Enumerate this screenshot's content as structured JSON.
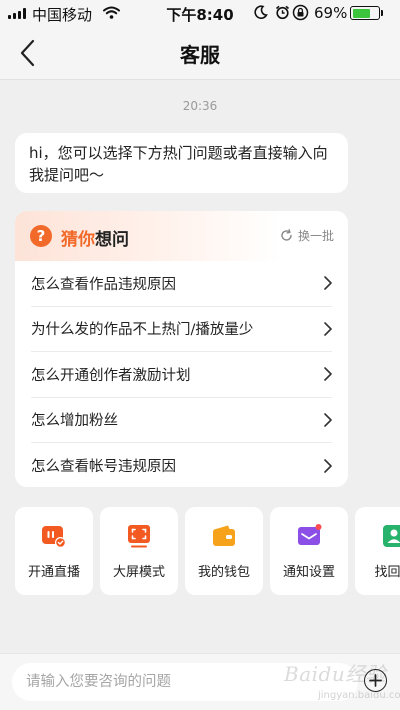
{
  "status_bar": {
    "carrier": "中国移动",
    "time": "下午8:40",
    "battery_percent": "69%",
    "battery_level": 0.69,
    "icons": [
      "signal-icon",
      "wifi-icon",
      "moon-icon",
      "alarm-icon",
      "rotation-lock-icon",
      "battery-icon"
    ]
  },
  "nav": {
    "title": "客服",
    "back_icon": "back-arrow-icon"
  },
  "chat": {
    "timestamp": "20:36",
    "message": "hi，您可以选择下方热门问题或者直接输入向我提问吧～"
  },
  "suggest": {
    "title_accent": "猜你",
    "title_rest": "想问",
    "refresh_label": "换一批",
    "items": [
      {
        "label": "怎么查看作品违规原因"
      },
      {
        "label": "为什么发的作品不上热门/播放量少"
      },
      {
        "label": "怎么开通创作者激励计划"
      },
      {
        "label": "怎么增加粉丝"
      },
      {
        "label": "怎么查看帐号违规原因"
      }
    ]
  },
  "quick_actions": [
    {
      "label": "开通直播",
      "icon": "live-icon",
      "color": "#f25a22"
    },
    {
      "label": "大屏模式",
      "icon": "fullscreen-icon",
      "color": "#f25a22"
    },
    {
      "label": "我的钱包",
      "icon": "wallet-icon",
      "color": "#f7a21b"
    },
    {
      "label": "通知设置",
      "icon": "notification-icon",
      "color": "#8b4ee6"
    },
    {
      "label": "找回帐",
      "icon": "account-recovery-icon",
      "color": "#27b36b"
    }
  ],
  "input": {
    "placeholder": "请输入您要咨询的问题",
    "plus_icon": "plus-icon"
  },
  "watermark": {
    "text": "Baidu经验",
    "sub": "jingyan.baidu.com"
  }
}
